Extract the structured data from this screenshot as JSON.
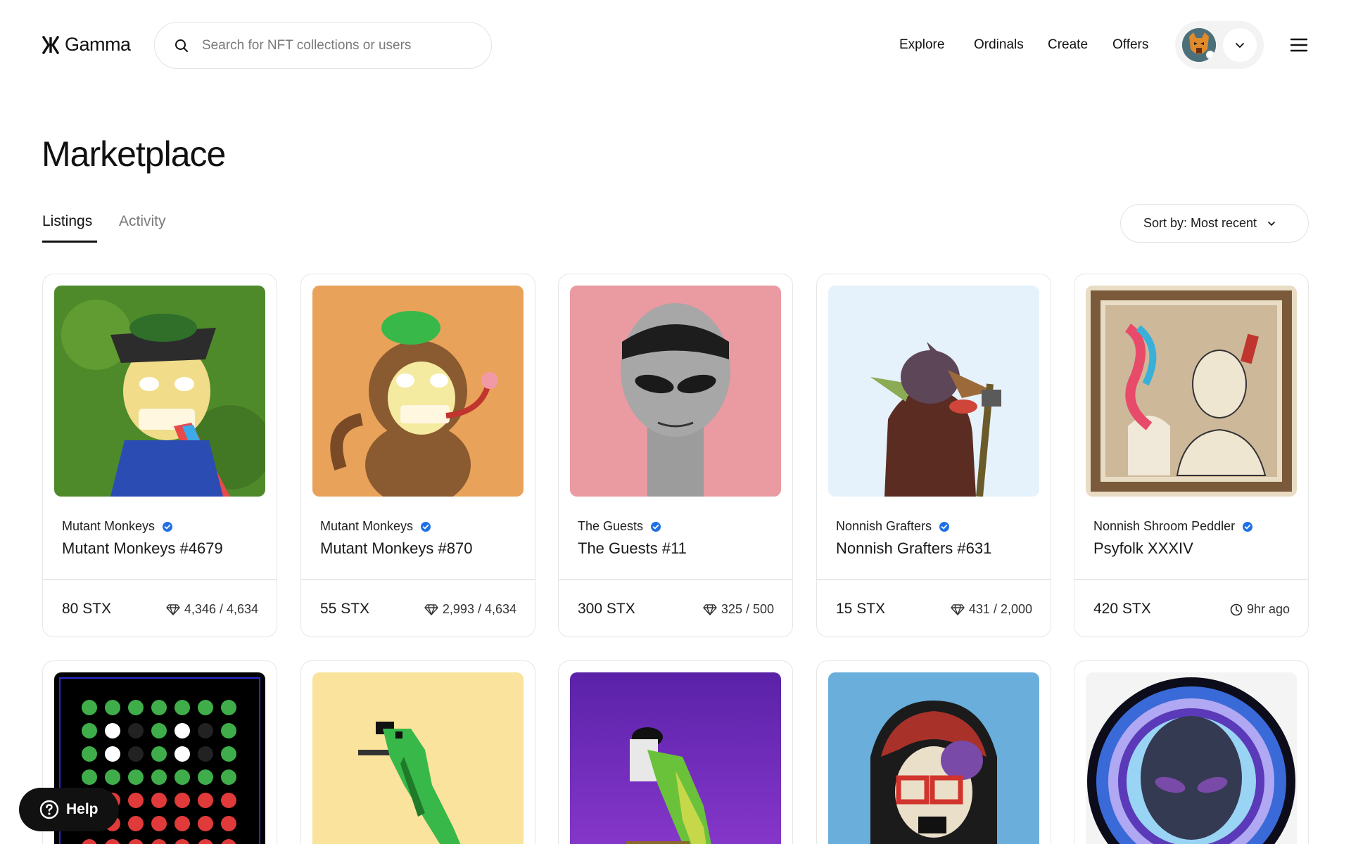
{
  "header": {
    "logo_text": "Gamma",
    "search_placeholder": "Search for NFT collections or users",
    "nav": [
      "Explore",
      "Ordinals",
      "Create",
      "Offers"
    ]
  },
  "page": {
    "title": "Marketplace",
    "tabs": [
      {
        "label": "Listings",
        "active": true
      },
      {
        "label": "Activity",
        "active": false
      }
    ],
    "sort_label": "Sort by: Most recent"
  },
  "listings": [
    {
      "collection": "Mutant Monkeys",
      "name": "Mutant Monkeys #4679",
      "price": "80 STX",
      "rarity": "4,346 / 4,634",
      "art_bg": "#4e8a2a"
    },
    {
      "collection": "Mutant Monkeys",
      "name": "Mutant Monkeys #870",
      "price": "55 STX",
      "rarity": "2,993 / 4,634",
      "art_bg": "#e9a25a"
    },
    {
      "collection": "The Guests",
      "name": "The Guests #11",
      "price": "300 STX",
      "rarity": "325 / 500",
      "art_bg": "#ea9aa1"
    },
    {
      "collection": "Nonnish Grafters",
      "name": "Nonnish Grafters #631",
      "price": "15 STX",
      "rarity": "431 / 2,000",
      "art_bg": "#e6f2fb"
    },
    {
      "collection": "Nonnish Shroom Peddler",
      "name": "Psyfolk XXXIV",
      "price": "420 STX",
      "time": "9hr ago",
      "art_bg": "#e8dcc4"
    }
  ],
  "second_row_backgrounds": [
    "#000000",
    "#fae39c",
    "#6a2bb0",
    "#6aaedb",
    "#f4f4f4"
  ],
  "help_label": "Help",
  "colors": {
    "verified": "#1f6fe5",
    "text": "#1a1a1a",
    "muted": "#7a7a7a",
    "border": "#e6e6e6",
    "help_bg": "#111111"
  }
}
